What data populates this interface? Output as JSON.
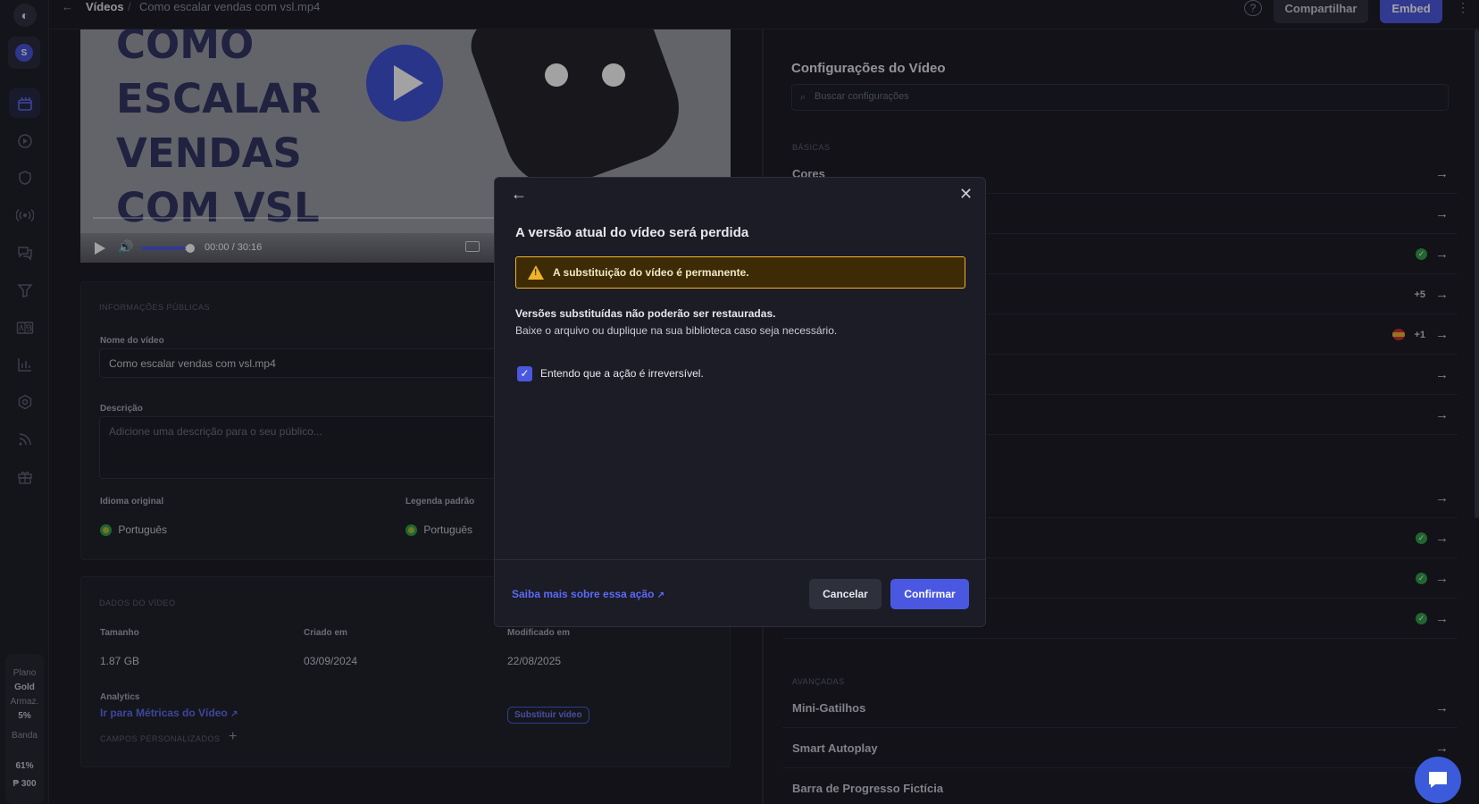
{
  "breadcrumb": {
    "back": "←",
    "section": "Vídeos",
    "separator": "/",
    "current": "Como escalar vendas com vsl.mp4"
  },
  "header": {
    "help": "?",
    "share_label": "Compartilhar",
    "embed_label": "Embed",
    "more": "⋮"
  },
  "sidebar": {
    "avatar": "S",
    "plan_label": "Plano",
    "plan_name": "Gold",
    "storage_label": "Armaz.",
    "storage_value": "5%",
    "bandwidth_label": "Banda",
    "bandwidth_value": "61%",
    "credits": "₱ 300"
  },
  "video": {
    "title_lines": "COMO\nESCALAR\nVENDAS\nCOM VSL",
    "time_current": "00:00",
    "time_sep": "/",
    "time_total": "30:16"
  },
  "public_info": {
    "section_label": "INFORMAÇÕES PÚBLICAS",
    "name_label": "Nome do vídeo",
    "name_value": "Como escalar vendas com vsl.mp4",
    "description_label": "Descrição",
    "description_placeholder": "Adicione uma descrição para o seu público...",
    "original_language_label": "Idioma original",
    "original_language_value": "Português",
    "default_subtitle_label": "Legenda padrão",
    "default_subtitle_value": "Português"
  },
  "video_data": {
    "section_label": "DADOS DO VÍDEO",
    "size_label": "Tamanho",
    "size_value": "1.87 GB",
    "created_label": "Criado em",
    "created_value": "03/09/2024",
    "modified_label": "Modificado em",
    "modified_value": "22/08/2025",
    "analytics_label": "Analytics",
    "analytics_link": "Ir para Métricas do Vídeo",
    "replace_button": "Substituir vídeo",
    "custom_fields_label": "CAMPOS PERSONALIZADOS"
  },
  "settings": {
    "title": "Configurações do Vídeo",
    "search_placeholder": "Buscar configurações",
    "basic_label": "BÁSICAS",
    "advanced_label": "AVANÇADAS",
    "row_colors": "Cores",
    "row_extra_5": "+5",
    "row_extra_1": "+1",
    "row_mini_triggers": "Mini-Gatilhos",
    "row_smart_autoplay": "Smart Autoplay",
    "row_fake_progress": "Barra de Progresso Fictícia"
  },
  "modal": {
    "back": "←",
    "close": "✕",
    "title": "A versão atual do vídeo será perdida",
    "warning": "A substituição do vídeo é permanente.",
    "bold_text": "Versões substituídas não poderão ser restauradas.",
    "description": "Baixe o arquivo ou duplique na sua biblioteca caso seja necessário.",
    "checkbox_label": "Entendo que a ação é irreversível.",
    "checkbox_checked": true,
    "learn_more": "Saiba mais sobre essa ação",
    "cancel": "Cancelar",
    "confirm": "Confirmar"
  },
  "colors": {
    "accent": "#4a57e0",
    "warning": "#f0b429",
    "success": "#2f9e44",
    "background": "#17181f"
  }
}
